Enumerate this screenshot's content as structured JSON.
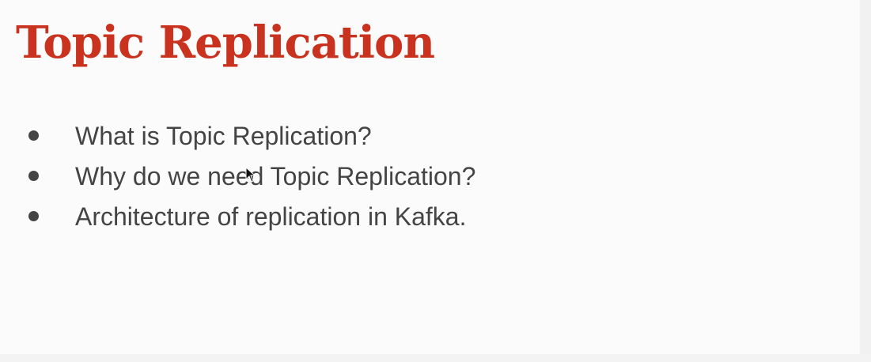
{
  "slide": {
    "title": "Topic Replication",
    "bullets": [
      "What is Topic Replication?",
      "Why do we need Topic Replication?",
      "Architecture of replication in Kafka."
    ]
  },
  "colors": {
    "title": "#c8321e",
    "body_text": "#444444",
    "background": "#fbfbfb"
  },
  "icons": {
    "cursor": "mouse-pointer-icon",
    "bullet": "bullet-dot-icon"
  }
}
